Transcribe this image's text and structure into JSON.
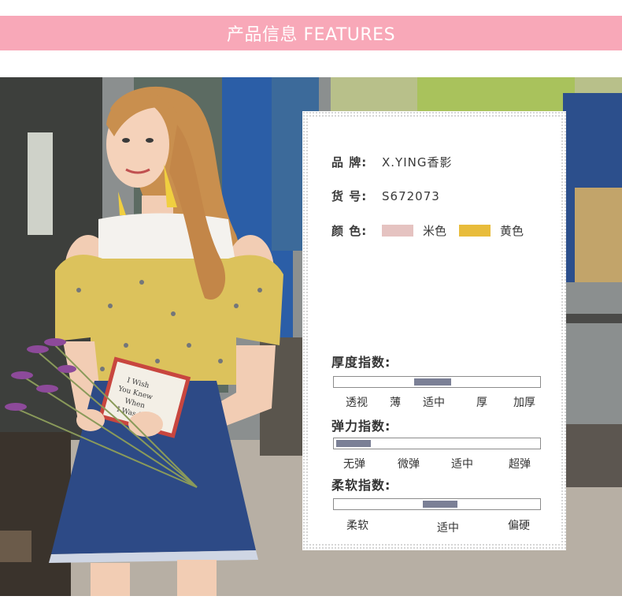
{
  "colors": {
    "header_bg": "#f8a8b8",
    "beige_swatch": "#e5c3c1",
    "yellow_swatch": "#e8bc3b",
    "indicator": "#7b8096"
  },
  "header": {
    "title": "产品信息 FEATURES"
  },
  "photo": {
    "book_text": [
      "I Wish",
      "You Knew",
      "When",
      "I Was 20"
    ]
  },
  "info": {
    "brand_label": "品 牌:",
    "brand_value": "X.YING香影",
    "sku_label": "货 号:",
    "sku_value": "S672073",
    "color_label": "颜 色:",
    "color_options": [
      {
        "name": "米色",
        "swatch": "#e5c3c1"
      },
      {
        "name": "黄色",
        "swatch": "#e8bc3b"
      }
    ]
  },
  "indices": [
    {
      "title": "厚度指数:",
      "levels": [
        "透视",
        "薄",
        "适中",
        "厚",
        "加厚"
      ],
      "selected": "适中",
      "selected_range": [
        0.39,
        0.57
      ]
    },
    {
      "title": "弹力指数:",
      "levels": [
        "无弹",
        "微弹",
        "适中",
        "超弹"
      ],
      "selected": "无弹",
      "selected_range": [
        0.01,
        0.18
      ]
    },
    {
      "title": "柔软指数:",
      "levels": [
        "柔软",
        "适中",
        "偏硬"
      ],
      "selected": "适中",
      "selected_range": [
        0.43,
        0.6
      ]
    }
  ]
}
